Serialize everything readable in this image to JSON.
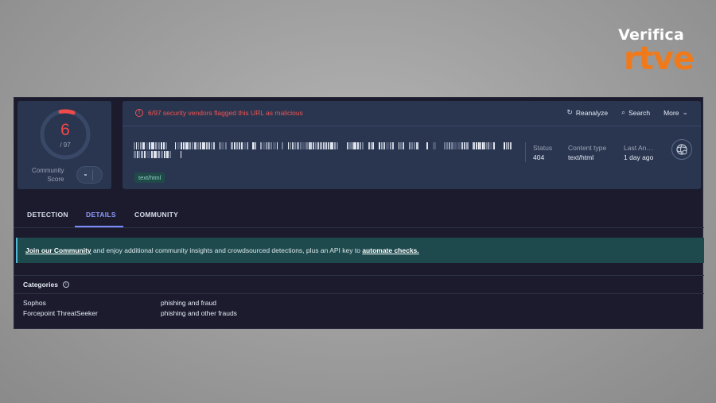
{
  "brand": {
    "top": "Verifica",
    "bottom": "rtve"
  },
  "score": {
    "value": "6",
    "total": "/ 97",
    "community_label_1": "Community",
    "community_label_2": "Score"
  },
  "alert": {
    "text": "6/97 security vendors flagged this URL as malicious"
  },
  "actions": {
    "reanalyze": "Reanalyze",
    "search": "Search",
    "more": "More"
  },
  "content_tag": "text/html",
  "meta": [
    {
      "label": "Status",
      "value": "404"
    },
    {
      "label": "Content type",
      "value": "text/html"
    },
    {
      "label": "Last An…",
      "value": "1 day ago"
    }
  ],
  "tabs": [
    {
      "label": "DETECTION"
    },
    {
      "label": "DETAILS"
    },
    {
      "label": "COMMUNITY"
    }
  ],
  "active_tab": "DETAILS",
  "banner": {
    "link1": "Join our Community",
    "middle": " and enjoy additional community insights and crowdsourced detections, plus an API key to ",
    "link2": "automate checks."
  },
  "categories": {
    "title": "Categories",
    "rows": [
      {
        "vendor": "Sophos",
        "category": "phishing and fraud"
      },
      {
        "vendor": "Forcepoint ThreatSeeker",
        "category": "phishing and other frauds"
      }
    ]
  },
  "colors": {
    "accent": "#7b8cff",
    "danger": "#f05252",
    "card": "#2a3650",
    "app_bg": "#1b1b2d",
    "brand_orange": "#f07a1a"
  }
}
